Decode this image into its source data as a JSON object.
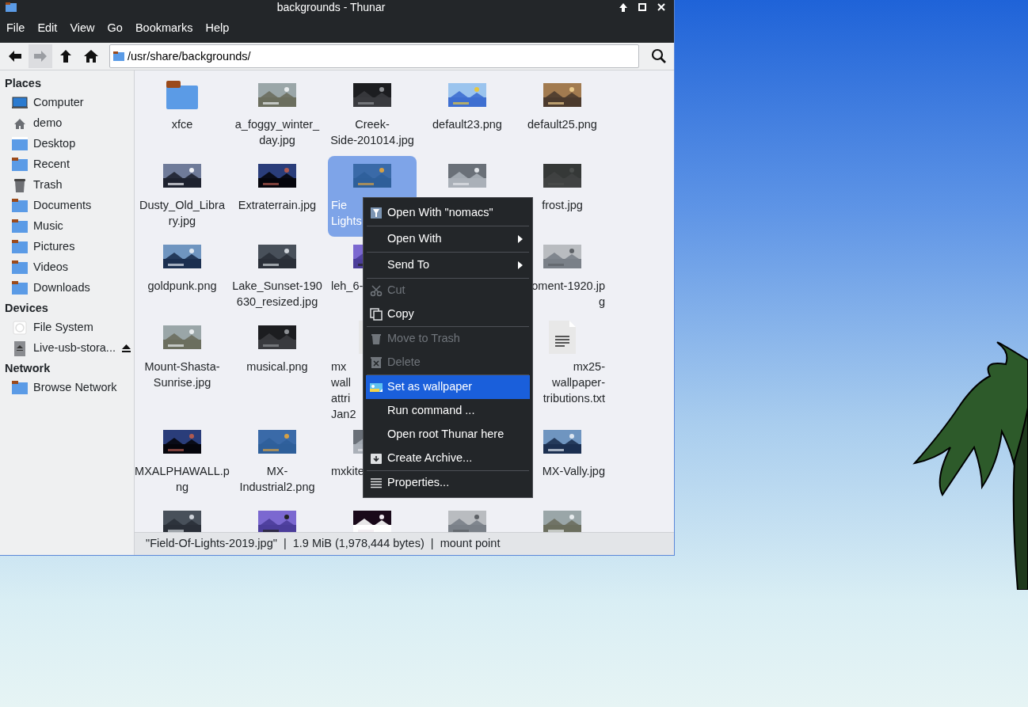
{
  "window": {
    "title": "backgrounds - Thunar"
  },
  "menubar": [
    "File",
    "Edit",
    "View",
    "Go",
    "Bookmarks",
    "Help"
  ],
  "toolbar": [
    {
      "kind": "back",
      "disabled": false
    },
    {
      "kind": "forward",
      "disabled": true
    },
    {
      "kind": "up",
      "disabled": false
    },
    {
      "kind": "home",
      "disabled": false
    }
  ],
  "location": {
    "value": "/usr/share/backgrounds/"
  },
  "sidebar": [
    {
      "heading": "Places",
      "items": [
        {
          "label": "Computer",
          "kind": "computer"
        },
        {
          "label": "demo",
          "kind": "home"
        },
        {
          "label": "Desktop",
          "kind": "desktop"
        },
        {
          "label": "Recent",
          "kind": "folder"
        },
        {
          "label": "Trash",
          "kind": "trash"
        },
        {
          "label": "Documents",
          "kind": "folder"
        },
        {
          "label": "Music",
          "kind": "folder"
        },
        {
          "label": "Pictures",
          "kind": "folder"
        },
        {
          "label": "Videos",
          "kind": "folder"
        },
        {
          "label": "Downloads",
          "kind": "folder"
        }
      ]
    },
    {
      "heading": "Devices",
      "items": [
        {
          "label": "File System",
          "kind": "disk"
        },
        {
          "label": "Live-usb-stora...",
          "kind": "usb",
          "eject": true
        }
      ]
    },
    {
      "heading": "Network",
      "items": [
        {
          "label": "Browse Network",
          "kind": "folder"
        }
      ]
    }
  ],
  "files": [
    {
      "kind": "folder",
      "lines": [
        "xfce"
      ],
      "selected": false
    },
    {
      "kind": "picture",
      "lines": [
        "a_foggy_winter_",
        "day.jpg"
      ],
      "selected": false
    },
    {
      "kind": "picture",
      "lines": [
        "Creek-",
        "Side-201014.jpg"
      ],
      "selected": false
    },
    {
      "kind": "picture",
      "lines": [
        "default23.png"
      ],
      "selected": false
    },
    {
      "kind": "picture",
      "lines": [
        "default25.png"
      ],
      "selected": false
    },
    {
      "kind": "picture",
      "lines": [
        "Dusty_Old_Libra",
        "ry.jpg"
      ],
      "selected": false
    },
    {
      "kind": "picture",
      "lines": [
        "Extraterrain.jpg"
      ],
      "selected": false
    },
    {
      "kind": "picture",
      "lines": [
        "Fie",
        "Lights"
      ],
      "selected": true
    },
    {
      "kind": "picture"
    },
    {
      "kind": "picture",
      "lines": [
        "frost.jpg"
      ],
      "selected": false
    },
    {
      "kind": "picture",
      "lines": [
        "goldpunk.png"
      ],
      "selected": false
    },
    {
      "kind": "picture",
      "lines": [
        "Lake_Sunset-190",
        "630_resized.jpg"
      ],
      "selected": false
    },
    {
      "kind": "picture",
      "lines": [
        "leh_6-"
      ],
      "selected": false
    },
    {
      "kind": "hidden"
    },
    {
      "kind": "picture",
      "lines": [
        "oment-1920.jp",
        "g"
      ],
      "selected": false
    },
    {
      "kind": "picture",
      "lines": [
        "Mount-Shasta-",
        "Sunrise.jpg"
      ],
      "selected": false
    },
    {
      "kind": "picture",
      "lines": [
        "musical.png"
      ],
      "selected": false
    },
    {
      "kind": "document",
      "lines": [
        "mx",
        "wall",
        "attri",
        "Jan2"
      ],
      "selected": false
    },
    {
      "kind": "hidden"
    },
    {
      "kind": "document",
      "lines": [
        "mx25-",
        "wallpaper-",
        "tributions.txt"
      ],
      "selected": false
    },
    {
      "kind": "picture",
      "lines": [
        "MXALPHAWALL.p",
        "ng"
      ],
      "selected": false
    },
    {
      "kind": "picture",
      "lines": [
        "MX-",
        "Industrial2.png"
      ],
      "selected": false
    },
    {
      "kind": "picture",
      "lines": [
        "mxkite"
      ],
      "selected": false
    },
    {
      "kind": "hidden"
    },
    {
      "kind": "picture",
      "lines": [
        "MX-Vally.jpg"
      ],
      "selected": false
    },
    {
      "kind": "picture"
    },
    {
      "kind": "picture"
    },
    {
      "kind": "picture"
    },
    {
      "kind": "picture"
    },
    {
      "kind": "picture"
    }
  ],
  "context_menu": [
    [
      {
        "label": "Open With \"nomacs\"",
        "kind": "app",
        "disabled": false,
        "selected": false
      }
    ],
    [
      {
        "label": "Open With",
        "kind": "plain",
        "submenu": true,
        "disabled": false,
        "selected": false
      }
    ],
    [
      {
        "label": "Send To",
        "kind": "plain",
        "submenu": true,
        "disabled": false,
        "selected": false
      }
    ],
    [
      {
        "label": "Cut",
        "kind": "cut",
        "disabled": true,
        "selected": false
      },
      {
        "label": "Copy",
        "kind": "copy",
        "disabled": false,
        "selected": false
      }
    ],
    [
      {
        "label": "Move to Trash",
        "kind": "trash",
        "disabled": true,
        "selected": false
      },
      {
        "label": "Delete",
        "kind": "delete",
        "disabled": true,
        "selected": false
      }
    ],
    [
      {
        "label": "Set as wallpaper",
        "kind": "wallpaper",
        "disabled": false,
        "selected": true
      },
      {
        "label": "Run command ...",
        "kind": "plain",
        "disabled": false,
        "selected": false
      },
      {
        "label": "Open root Thunar here",
        "kind": "plain",
        "disabled": false,
        "selected": false
      },
      {
        "label": "Create Archive...",
        "kind": "archive",
        "disabled": false,
        "selected": false
      }
    ],
    [
      {
        "label": "Properties...",
        "kind": "properties",
        "disabled": false,
        "selected": false
      }
    ]
  ],
  "status_bar": "\"Field-Of-Lights-2019.jpg\"  |  1.9 MiB (1,978,444 bytes)  |  mount point"
}
